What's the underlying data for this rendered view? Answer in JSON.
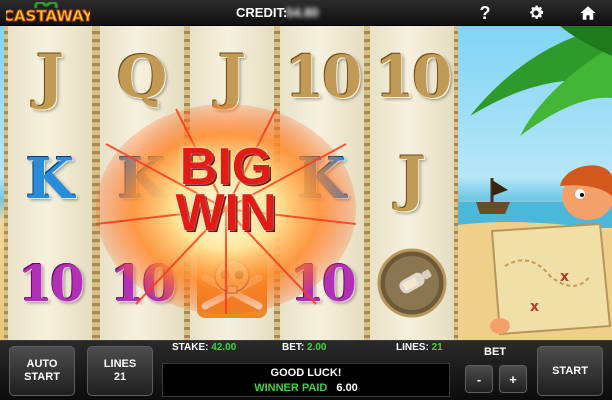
{
  "topbar": {
    "logo_text": "CASTAWAY",
    "credit_label": "CREDIT:",
    "credit_value": "54.80",
    "help_icon": "question-mark-icon",
    "settings_icon": "gear-icon",
    "home_icon": "home-icon"
  },
  "reels": [
    {
      "symbols": [
        "J",
        "K",
        "10"
      ]
    },
    {
      "symbols": [
        "Q",
        "K",
        "10"
      ]
    },
    {
      "symbols": [
        "J",
        "K",
        "skull"
      ]
    },
    {
      "symbols": [
        "10",
        "K",
        "10"
      ]
    },
    {
      "symbols": [
        "10",
        "J",
        "bottle-coin"
      ]
    }
  ],
  "bigwin": {
    "line1": "BIG",
    "line2": "WIN"
  },
  "panel": {
    "autostart_line1": "AUTO",
    "autostart_line2": "START",
    "lines_label": "LINES",
    "lines_value": "21",
    "stake_label": "STAKE:",
    "stake_value": "42.00",
    "bet_info_label": "BET:",
    "bet_info_value": "2.00",
    "lines_info_label": "LINES:",
    "lines_info_value": "21",
    "message1": "GOOD LUCK!",
    "message2_label": "WINNER PAID",
    "message2_value": "6.00",
    "bet_label": "BET",
    "minus": "-",
    "plus": "+",
    "start": "START"
  },
  "colors": {
    "accent_green": "#3ed23a",
    "bigwin_red": "#e21b14"
  }
}
